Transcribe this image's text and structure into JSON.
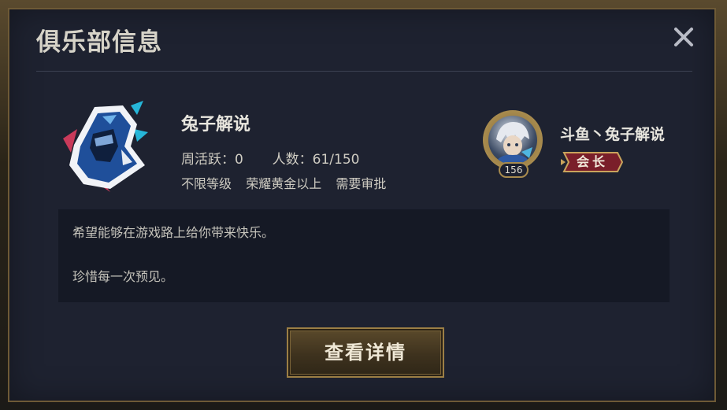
{
  "dialog": {
    "title": "俱乐部信息",
    "close_icon": "close-icon"
  },
  "club": {
    "logo_icon": "hooded-ninja-logo",
    "name": "兔子解说",
    "weekly_active_label": "周活跃：",
    "weekly_active_value": "0",
    "members_label": "人数：",
    "members_value": "61/150",
    "requirement_level": "不限等级",
    "requirement_rank": "荣耀黄金以上",
    "requirement_approval": "需要审批"
  },
  "leader": {
    "level": "156",
    "name": "斗鱼丶兔子解说",
    "role": "会长"
  },
  "description": {
    "line1": "希望能够在游戏路上给你带来快乐。",
    "line2": "珍惜每一次预见。"
  },
  "actions": {
    "view_details": "查看详情"
  },
  "colors": {
    "panel_bg": "#1e2230",
    "gold_border": "#9c7f45",
    "text_primary": "#e8e6de",
    "desc_bg": "#151925"
  }
}
